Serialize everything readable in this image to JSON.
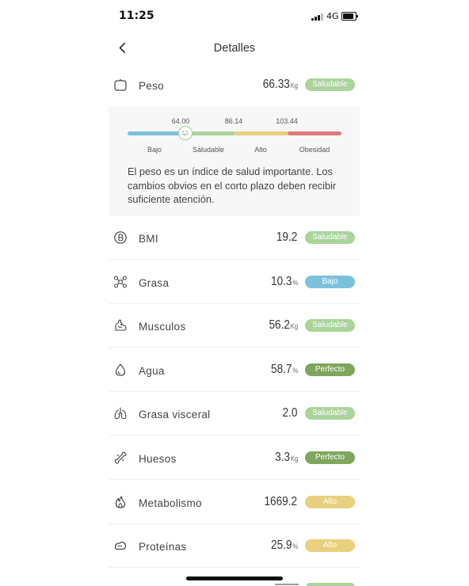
{
  "status_bar": {
    "time": "11:25",
    "network": "4G"
  },
  "nav": {
    "title": "Detalles"
  },
  "weight": {
    "label": "Peso",
    "value": "66.33",
    "unit": "Kg",
    "badge": "Saludable",
    "scale": {
      "ticks": [
        "64.00",
        "86.14",
        "103.44"
      ],
      "categories": [
        "Bajo",
        "Saludable",
        "Alto",
        "Obesidad"
      ],
      "colors": [
        "#7cc1dc",
        "#a9d49a",
        "#e9d07e",
        "#df7a7a"
      ]
    },
    "description": "El peso es un índice de salud importante. Los cambios obvios en el corto plazo deben recibir suficiente atención."
  },
  "metrics": [
    {
      "label": "BMI",
      "value": "19.2",
      "unit": "",
      "badge": "Saludable",
      "color": "#a9d49a",
      "icon": "b-circle-icon"
    },
    {
      "label": "Grasa",
      "value": "10.3",
      "unit": "%",
      "badge": "Bajo",
      "color": "#7cc1dc",
      "icon": "fat-molecule-icon"
    },
    {
      "label": "Musculos",
      "value": "56.2",
      "unit": "Kg",
      "badge": "Saludable",
      "color": "#a9d49a",
      "icon": "muscle-arm-icon"
    },
    {
      "label": "Agua",
      "value": "58.7",
      "unit": "%",
      "badge": "Perfecto",
      "color": "#7ea65c",
      "icon": "water-drop-icon"
    },
    {
      "label": "Grasa visceral",
      "value": "2.0",
      "unit": "",
      "badge": "Saludable",
      "color": "#a9d49a",
      "icon": "lungs-icon"
    },
    {
      "label": "Huesos",
      "value": "3.3",
      "unit": "Kg",
      "badge": "Perfecto",
      "color": "#7ea65c",
      "icon": "bone-icon"
    },
    {
      "label": "Metabolismo",
      "value": "1669.2",
      "unit": "",
      "badge": "Alto",
      "color": "#e9d07e",
      "icon": "flame-icon"
    },
    {
      "label": "Proteínas",
      "value": "25.9",
      "unit": "%",
      "badge": "Alto",
      "color": "#e9d07e",
      "icon": "protein-icon"
    }
  ]
}
